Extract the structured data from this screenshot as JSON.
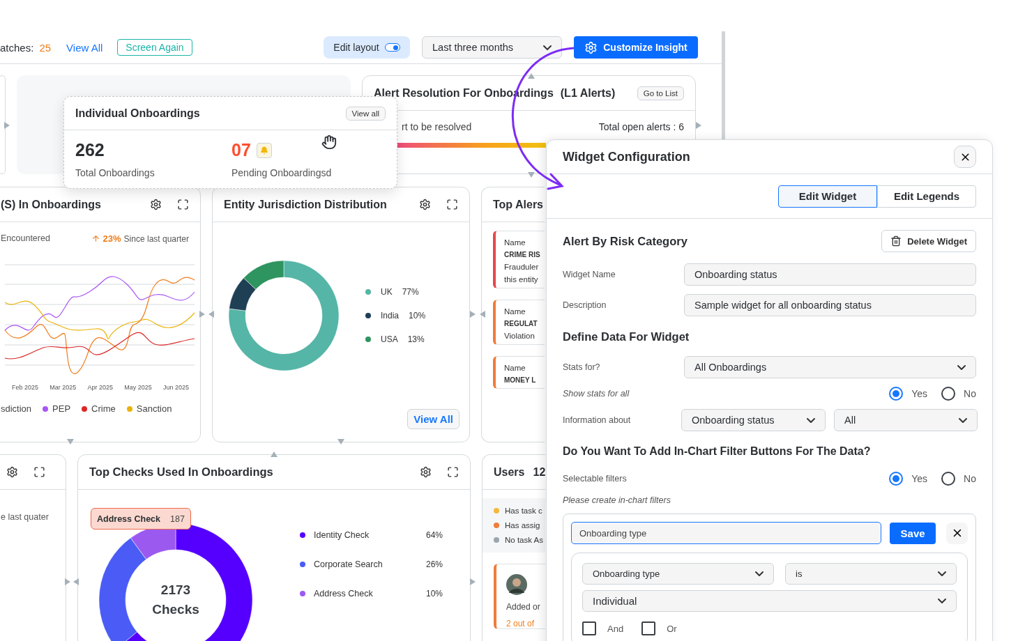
{
  "top_bar": {
    "matches_label": "atches:",
    "matches_count": "25",
    "view_all": "View All",
    "screen_again": "Screen Again",
    "edit_layout": {
      "label": "Edit layout",
      "on": true
    },
    "period": "Last three months",
    "customize": "Customize Insight"
  },
  "alert_resolution": {
    "title": "Alert Resolution For Onboardings",
    "badge": "(L1 Alerts)",
    "go_to_list": "Go to List",
    "left_text": "rt to be resolved",
    "total": "Total open alerts : 6"
  },
  "floating_card": {
    "title": "Individual Onboardings",
    "view_all": "View all",
    "total": "262",
    "total_label": "Total Onboardings",
    "pending": "07",
    "pending_label": "Pending Onboardingsd"
  },
  "risk_card": {
    "title": "(S) In Onboardings",
    "subtitle": "Encountered",
    "change": "23%",
    "change_label": "Since last quarter",
    "x_labels": [
      "Feb 2025",
      "Mar 2025",
      "Apr 2025",
      "May 2025",
      "Jun 2025"
    ],
    "legend_cut": "sdiction",
    "legend": [
      {
        "label": "PEP",
        "color": "#a855f7"
      },
      {
        "label": "Crime",
        "color": "#dc2626"
      },
      {
        "label": "Sanction",
        "color": "#eab308"
      }
    ]
  },
  "jurisdiction_card": {
    "title": "Entity Jurisdiction Distribution",
    "chart_data": {
      "type": "donut",
      "categories": [
        "UK",
        "India",
        "USA"
      ],
      "values": [
        77,
        10,
        13
      ],
      "colors": [
        "#55b5a6",
        "#1f3f55",
        "#2e9460"
      ]
    },
    "legend_values": [
      "77%",
      "10%",
      "13%"
    ],
    "view_all": "View All"
  },
  "top_alerts": {
    "title": "Top Alers",
    "items": [
      {
        "color": "#e5484d",
        "lines": [
          "Name",
          "CRIME RIS",
          "Frauduler",
          "this entity"
        ]
      },
      {
        "color": "#f07c3a",
        "lines": [
          "Name",
          "REGULAT",
          "Violation"
        ]
      },
      {
        "color": "#f07c3a",
        "lines": [
          "Name",
          "MONEY L"
        ]
      }
    ]
  },
  "quarter_card": {
    "text": "e last quater"
  },
  "top_checks": {
    "title": "Top Checks Used In Onboardings",
    "tooltip": {
      "label": "Address Check",
      "value": "187"
    },
    "center_value": "2173",
    "center_label": "Checks",
    "chart_data": {
      "type": "donut",
      "categories": [
        "Identity Check",
        "Corporate Search",
        "Address Check"
      ],
      "values": [
        64,
        26,
        10
      ],
      "colors": [
        "#5500ff",
        "#4a5cf5",
        "#9b59f0"
      ]
    },
    "legend_values": [
      "64%",
      "26%",
      "10%"
    ]
  },
  "users": {
    "title": "Users",
    "count": "12",
    "legend": [
      {
        "label": "Has task c",
        "color": "#f5b83d"
      },
      {
        "label": "Has assig",
        "color": "#f07c3a"
      },
      {
        "label": "No task As",
        "color": "#9aa5ad"
      }
    ],
    "added": "Added or",
    "progress": "2 out of"
  },
  "widget_config": {
    "title": "Widget Configuration",
    "tabs": [
      {
        "label": "Edit Widget",
        "selected": true
      },
      {
        "label": "Edit Legends",
        "selected": false
      }
    ],
    "widget_title": "Alert By Risk Category",
    "delete": "Delete Widget",
    "fields": [
      {
        "label": "Widget Name",
        "value": "Onboarding status"
      },
      {
        "label": "Description",
        "value": "Sample widget for all onboarding status"
      }
    ],
    "define_title": "Define Data For Widget",
    "stats_for": {
      "label": "Stats for?",
      "value": "All Onboardings"
    },
    "show_stats": {
      "label": "Show stats for all",
      "options": [
        {
          "label": "Yes",
          "selected": true
        },
        {
          "label": "No",
          "selected": false
        }
      ]
    },
    "information": {
      "label": "Information about",
      "values": [
        "Onboarding status",
        "All"
      ]
    },
    "filter_question": "Do You Want To Add In-Chart Filter Buttons For The Data?",
    "selectable": {
      "label": "Selectable filters",
      "options": [
        {
          "label": "Yes",
          "selected": true
        },
        {
          "label": "No",
          "selected": false
        }
      ]
    },
    "filters_hint": "Please create in-chart filters",
    "filter": {
      "name": "Onboarding type",
      "save": "Save",
      "field": "Onboarding type",
      "operator": "is",
      "value": "Individual",
      "joins": [
        {
          "label": "And",
          "checked": false
        },
        {
          "label": "Or",
          "checked": false
        }
      ]
    }
  }
}
